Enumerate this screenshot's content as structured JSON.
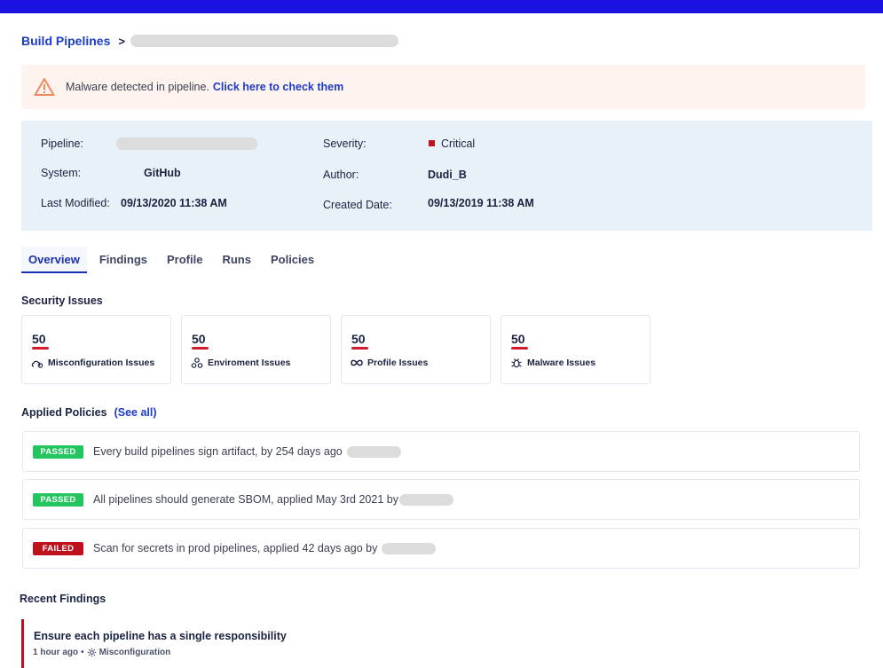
{
  "breadcrumb": {
    "root": "Build Pipelines",
    "separator": ">"
  },
  "alert": {
    "message": "Malware detected in pipeline.",
    "link": "Click here to check them",
    "icon": "warning-triangle-icon",
    "color": "#f08a5d"
  },
  "info": {
    "pipeline_label": "Pipeline:",
    "system_label": "System:",
    "system_value": "GitHub",
    "last_modified_label": "Last Modified:",
    "last_modified_value": "09/13/2020 11:38 AM",
    "severity_label": "Severity:",
    "severity_value": "Critical",
    "severity_color": "#c0121e",
    "author_label": "Author:",
    "author_value": "Dudi_B",
    "created_label": "Created Date:",
    "created_value": "09/13/2019 11:38 AM"
  },
  "tabs": [
    "Overview",
    "Findings",
    "Profile",
    "Runs",
    "Policies"
  ],
  "active_tab": "Overview",
  "security": {
    "title": "Security Issues",
    "cards": [
      {
        "count": "50",
        "label": "Misconfiguration Issues",
        "icon": "gear-cloud-icon"
      },
      {
        "count": "50",
        "label": "Enviroment Issues",
        "icon": "cluster-icon"
      },
      {
        "count": "50",
        "label": "Profile Issues",
        "icon": "infinity-icon"
      },
      {
        "count": "50",
        "label": "Malware Issues",
        "icon": "bug-icon"
      }
    ]
  },
  "policies": {
    "title": "Applied Policies",
    "see_all": "(See all)",
    "items": [
      {
        "status": "PASSED",
        "text": "Every build pipelines sign artifact, by 254 days ago"
      },
      {
        "status": "PASSED",
        "text": "All pipelines should generate SBOM, applied May 3rd 2021  by"
      },
      {
        "status": "FAILED",
        "text": "Scan for secrets in prod pipelines, applied 42 days ago  by"
      }
    ]
  },
  "findings": {
    "title": "Recent Findings",
    "items": [
      {
        "title": "Ensure each pipeline has a single responsibility",
        "time": "1 hour ago",
        "dot": "•",
        "category": "Misconfiguration"
      }
    ]
  },
  "colors": {
    "brand": "#1a12e0",
    "link": "#1a3cc8",
    "passed": "#22c55e",
    "failed": "#c0121e"
  }
}
